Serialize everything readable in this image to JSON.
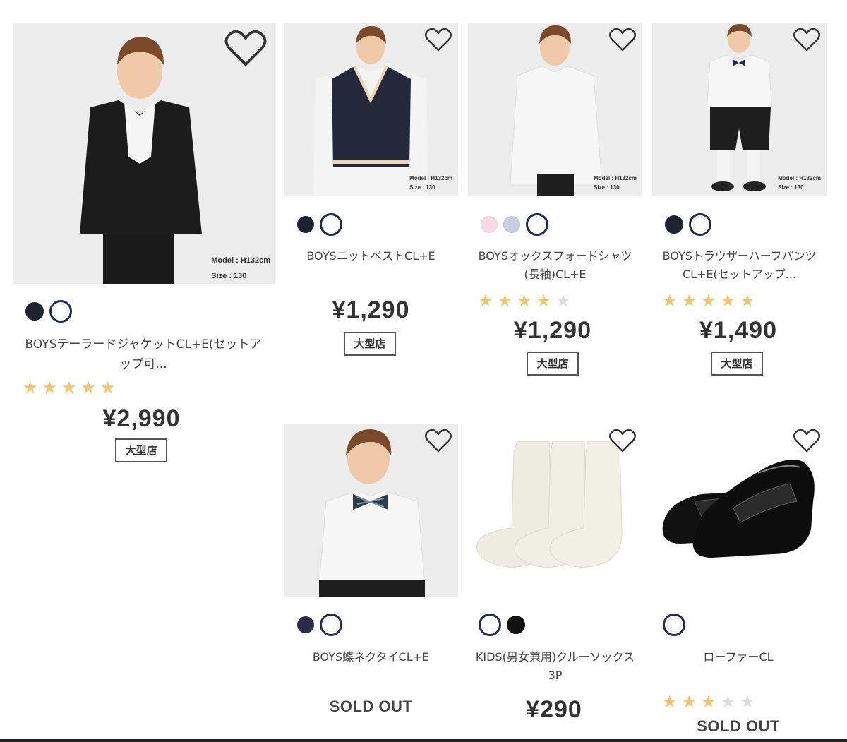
{
  "products": [
    {
      "name": "BOYSテーラードジャケットCL+E(セットアップ可...",
      "model_note_1": "Model : H132cm",
      "model_note_2": "Size : 130",
      "swatches": [
        "#1e2130",
        "#2a2a2a"
      ],
      "selected_swatch": 1,
      "rating": 5,
      "price": "¥2,990",
      "badge": "大型店"
    },
    {
      "name": "BOYSニットベストCL+E",
      "model_note_1": "Model : H132cm",
      "model_note_2": "Size : 130",
      "swatches": [
        "#1e2130",
        "#f1ede0"
      ],
      "selected_swatch": 1,
      "rating": null,
      "price": "¥1,290",
      "badge": "大型店"
    },
    {
      "name": "BOYSオックスフォードシャツ(長袖)CL+E",
      "model_note_1": "Model : H132cm",
      "model_note_2": "Size : 130",
      "swatches": [
        "#f6dbe6",
        "#c9cde0",
        "#fafafa"
      ],
      "selected_swatch": 2,
      "rating": 4,
      "price": "¥1,290",
      "badge": "大型店"
    },
    {
      "name": "BOYSトラウザーハーフパンツCL+E(セットアップ...",
      "model_note_1": "Model : H132cm",
      "model_note_2": "Size : 130",
      "swatches": [
        "#1e2130",
        "#2a2a2a"
      ],
      "selected_swatch": 1,
      "rating": 5,
      "price": "¥1,490",
      "badge": "大型店"
    },
    {
      "name": "BOYS蝶ネクタイCL+E",
      "swatches": [
        "#2b2a4a",
        "#2c3e4c"
      ],
      "selected_swatch": 1,
      "rating": null,
      "status": "SOLD OUT"
    },
    {
      "name": "KIDS(男女兼用)クルーソックス3P",
      "swatches": [
        "#f1ede0",
        "#111111"
      ],
      "selected_swatch": 0,
      "rating": null,
      "price": "¥290"
    },
    {
      "name": "ローファーCL",
      "swatches": [
        "#1f1f1f"
      ],
      "selected_swatch": 0,
      "rating": 3,
      "status": "SOLD OUT"
    }
  ],
  "colors": {
    "star_on": "#f3c46c",
    "star_off": "#dcdcdc",
    "selected_ring": "#1f2a5c"
  },
  "icons": {
    "favorite": "heart-outline-icon",
    "rating": "star-icon"
  }
}
